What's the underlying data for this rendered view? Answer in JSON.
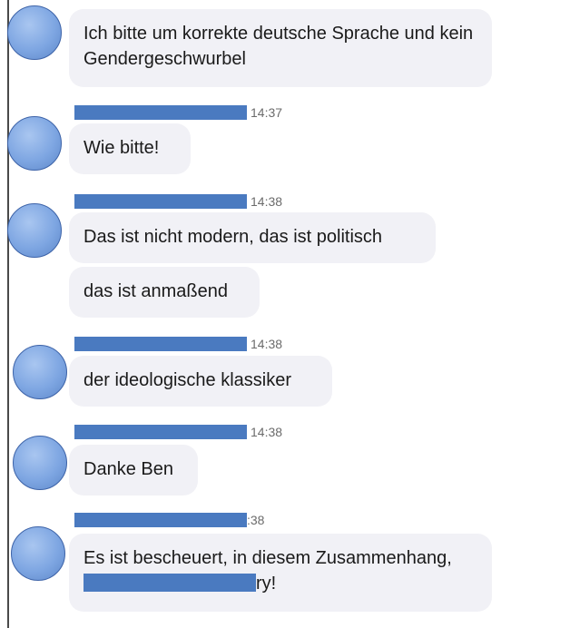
{
  "messages": [
    {
      "time": "",
      "text": "Ich bitte um korrekte deutsche Sprache und kein Gendergeschwurbel"
    },
    {
      "time": "14:37",
      "text": "Wie bitte!"
    },
    {
      "time": "14:38",
      "text": "Das ist nicht modern, das ist politisch"
    },
    {
      "time": "",
      "text": "das ist anmaßend"
    },
    {
      "time": "14:38",
      "text": "der ideologische klassiker"
    },
    {
      "time": "14:38",
      "text": "Danke Ben"
    },
    {
      "time": ":38",
      "text_before": "Es ist bescheuert, in diesem Zusammenhang,",
      "text_after": "ry!"
    }
  ],
  "colors": {
    "avatar": "#7ea6e2",
    "redaction": "#4a7ac0",
    "bubble_bg": "#f1f1f6"
  }
}
